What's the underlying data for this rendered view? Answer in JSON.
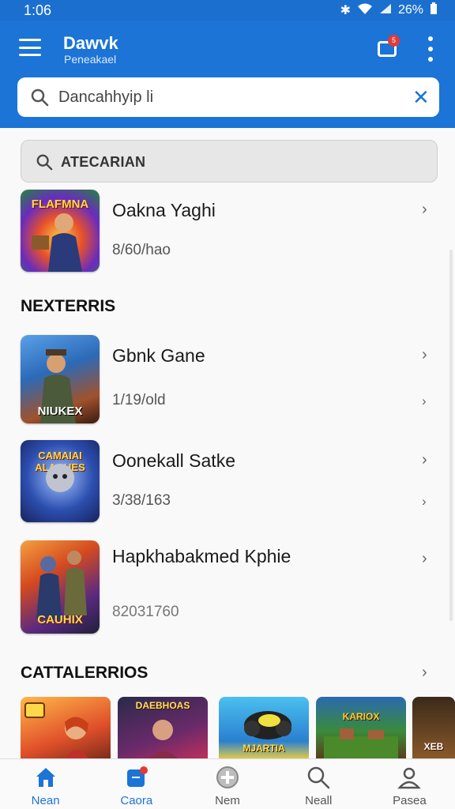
{
  "status": {
    "time": "1:06",
    "battery": "26%"
  },
  "header": {
    "title": "Dawvk",
    "subtitle": "Peneakael",
    "notification_count": "5"
  },
  "search": {
    "value": "Dancahhyip li"
  },
  "filter": {
    "label": "ATECARIAN"
  },
  "featured": {
    "title": "Oakna Yaghi",
    "meta": "8/60/hao",
    "badge": "FLAFMNA"
  },
  "sections": {
    "next": "NEXTERRIS",
    "categories": "CATTALERRIOS"
  },
  "list": [
    {
      "title": "Gbnk Gane",
      "meta": "1/19/old",
      "badge": "NIUKEX"
    },
    {
      "title": "Oonekall Satke",
      "meta": "3/38/163",
      "badge": "CAMAIAI ALAGHES"
    },
    {
      "title": "Hapkhabakmed Kphie",
      "meta": "82031760",
      "badge": "CAUHIX"
    }
  ],
  "category_tiles": [
    {
      "label": ""
    },
    {
      "label": "DAEBHOAS"
    },
    {
      "label": "MJARTIA"
    },
    {
      "label": "KARIOX"
    },
    {
      "label": "XEB"
    }
  ],
  "bottom_nav": [
    {
      "label": "Nean",
      "icon": "home-icon"
    },
    {
      "label": "Caora",
      "icon": "library-icon"
    },
    {
      "label": "Nem",
      "icon": "add-circle-icon"
    },
    {
      "label": "Neall",
      "icon": "search-icon"
    },
    {
      "label": "Pasea",
      "icon": "profile-icon"
    }
  ],
  "colors": {
    "primary": "#1b74d6",
    "badge": "#e53935"
  }
}
